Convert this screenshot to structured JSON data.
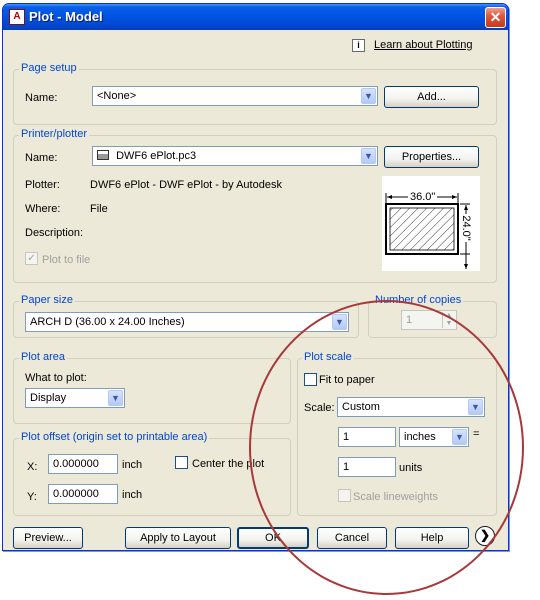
{
  "window": {
    "title": "Plot - Model",
    "app_icon": "autocad-icon",
    "close": "✕"
  },
  "help_link": {
    "icon": "info-icon",
    "icon_glyph": "i",
    "text": "Learn about Plotting"
  },
  "page_setup": {
    "legend": "Page setup",
    "name_label": "Name:",
    "name_value": "<None>",
    "add_button": "Add..."
  },
  "printer": {
    "legend": "Printer/plotter",
    "name_label": "Name:",
    "name_value": "DWF6 ePlot.pc3",
    "printer_icon": "printer-icon",
    "properties_button": "Properties...",
    "plotter_label": "Plotter:",
    "plotter_value": "DWF6 ePlot - DWF ePlot - by Autodesk",
    "where_label": "Where:",
    "where_value": "File",
    "description_label": "Description:",
    "plot_to_file": "Plot to file",
    "preview_width": "36.0\"",
    "preview_height": "24.0\""
  },
  "paper_size": {
    "legend": "Paper size",
    "value": "ARCH D (36.00 x 24.00 Inches)"
  },
  "copies": {
    "legend": "Number of copies",
    "value": "1"
  },
  "plot_area": {
    "legend": "Plot area",
    "what_label": "What to plot:",
    "value": "Display"
  },
  "plot_offset": {
    "legend": "Plot offset (origin set to printable area)",
    "x_label": "X:",
    "x_value": "0.000000",
    "x_unit": "inch",
    "y_label": "Y:",
    "y_value": "0.000000",
    "y_unit": "inch",
    "center_label": "Center the plot"
  },
  "plot_scale": {
    "legend": "Plot scale",
    "fit_label": "Fit to paper",
    "scale_label": "Scale:",
    "scale_value": "Custom",
    "value1": "1",
    "unit1": "inches",
    "equals": "=",
    "value2": "1",
    "unit2": "units",
    "lineweights_label": "Scale lineweights"
  },
  "footer": {
    "preview": "Preview...",
    "apply": "Apply to Layout",
    "ok": "OK",
    "cancel": "Cancel",
    "help": "Help",
    "expand_icon": "chevron-right-icon"
  }
}
